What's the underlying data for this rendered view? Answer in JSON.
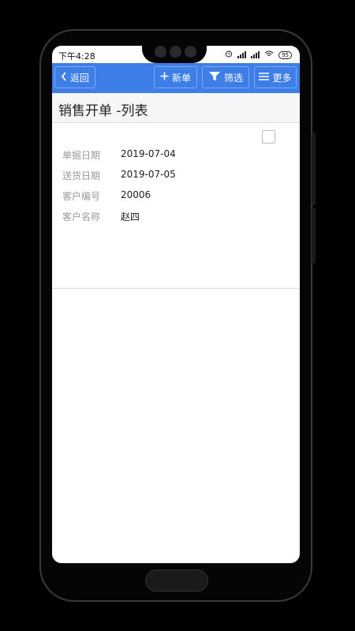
{
  "status_bar": {
    "time": "下午4:28",
    "battery": "95"
  },
  "toolbar": {
    "back_label": "返回",
    "new_label": "新单",
    "filter_label": "筛选",
    "more_label": "更多"
  },
  "page": {
    "title": "销售开单 -列表"
  },
  "record": {
    "fields": [
      {
        "label": "单据日期",
        "value": "2019-07-04"
      },
      {
        "label": "送货日期",
        "value": "2019-07-05"
      },
      {
        "label": "客户编号",
        "value": "20006"
      },
      {
        "label": "客户名称",
        "value": "赵四"
      }
    ],
    "selected": false
  },
  "colors": {
    "toolbar": "#3d7ee8",
    "title_bg": "#f6f6f8"
  }
}
